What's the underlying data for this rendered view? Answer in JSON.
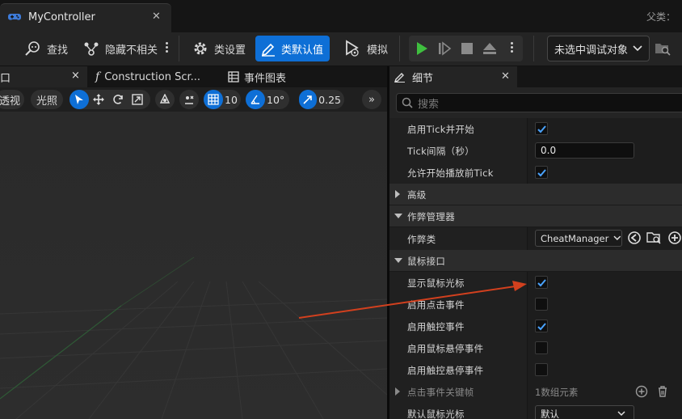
{
  "window": {
    "tab_title": "MyController",
    "parent_class_label": "父类："
  },
  "toolbar": {
    "find": "查找",
    "hide_unrelated": "隐藏不相关",
    "class_settings": "类设置",
    "class_defaults": "类默认值",
    "simulate": "模拟",
    "debug_target": "未选中调试对象"
  },
  "left_tabs": {
    "viewport_close": "×",
    "construction": "Construction Scr...",
    "event_graph": "事件图表"
  },
  "viewport_toolbar": {
    "perspective": "透视",
    "lighting": "光照",
    "grid_snap": "10",
    "rotation_snap": "10°",
    "scale_snap": "0.25"
  },
  "details": {
    "tab_title": "细节",
    "search_placeholder": "搜索",
    "rows": [
      {
        "label": "启用Tick并开始",
        "type": "checkbox",
        "checked": true
      },
      {
        "label": "Tick间隔（秒）",
        "type": "number",
        "value": "0.0"
      },
      {
        "label": "允许开始播放前Tick",
        "type": "checkbox",
        "checked": true
      },
      {
        "label": "高级",
        "type": "category",
        "expanded": false
      },
      {
        "label": "作弊管理器",
        "type": "category",
        "expanded": true
      },
      {
        "label": "作弊类",
        "type": "class",
        "value": "CheatManager"
      },
      {
        "label": "鼠标接口",
        "type": "category",
        "expanded": true
      },
      {
        "label": "显示鼠标光标",
        "type": "checkbox",
        "checked": true
      },
      {
        "label": "启用点击事件",
        "type": "checkbox",
        "checked": false
      },
      {
        "label": "启用触控事件",
        "type": "checkbox",
        "checked": true
      },
      {
        "label": "启用鼠标悬停事件",
        "type": "checkbox",
        "checked": false
      },
      {
        "label": "启用触控悬停事件",
        "type": "checkbox",
        "checked": false
      },
      {
        "label": "点击事件关键帧",
        "type": "array",
        "value": "1数组元素"
      },
      {
        "label": "默认鼠标光标",
        "type": "combo",
        "value": "默认"
      }
    ]
  },
  "colors": {
    "accent": "#0e6fd6",
    "checkmark": "#4aa3ff",
    "play_green": "#3fbf3f",
    "annotation_arrow": "#d2401e"
  }
}
